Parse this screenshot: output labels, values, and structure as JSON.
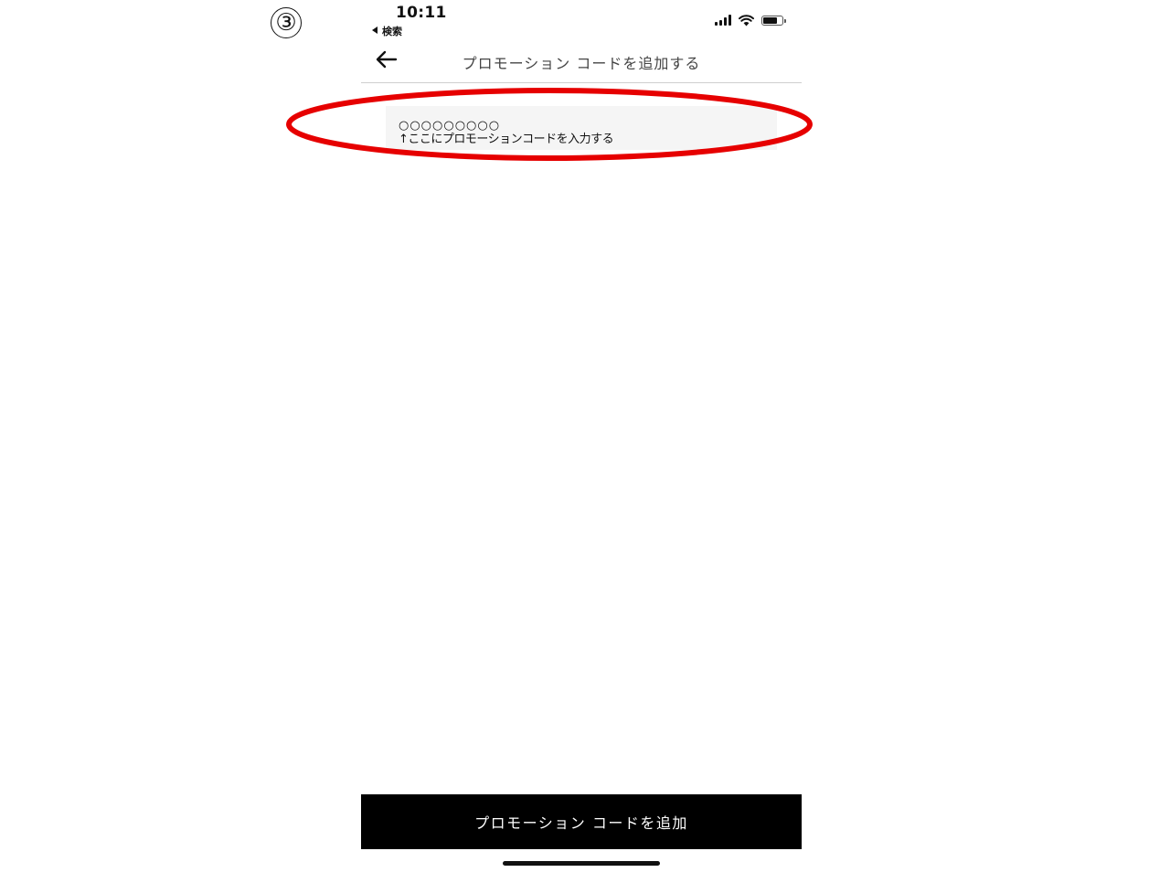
{
  "step_label": "③",
  "status_bar": {
    "time": "10:11",
    "back_label": "検索"
  },
  "header": {
    "title": "プロモーション コードを追加する"
  },
  "promo_field": {
    "value": "○○○○○○○○○",
    "hint": "↑ここにプロモーションコードを入力する"
  },
  "colors": {
    "highlight": "#e60000",
    "button_bg": "#000000",
    "field_bg": "#f5f5f5"
  },
  "footer": {
    "add_button_label": "プロモーション コードを追加"
  }
}
